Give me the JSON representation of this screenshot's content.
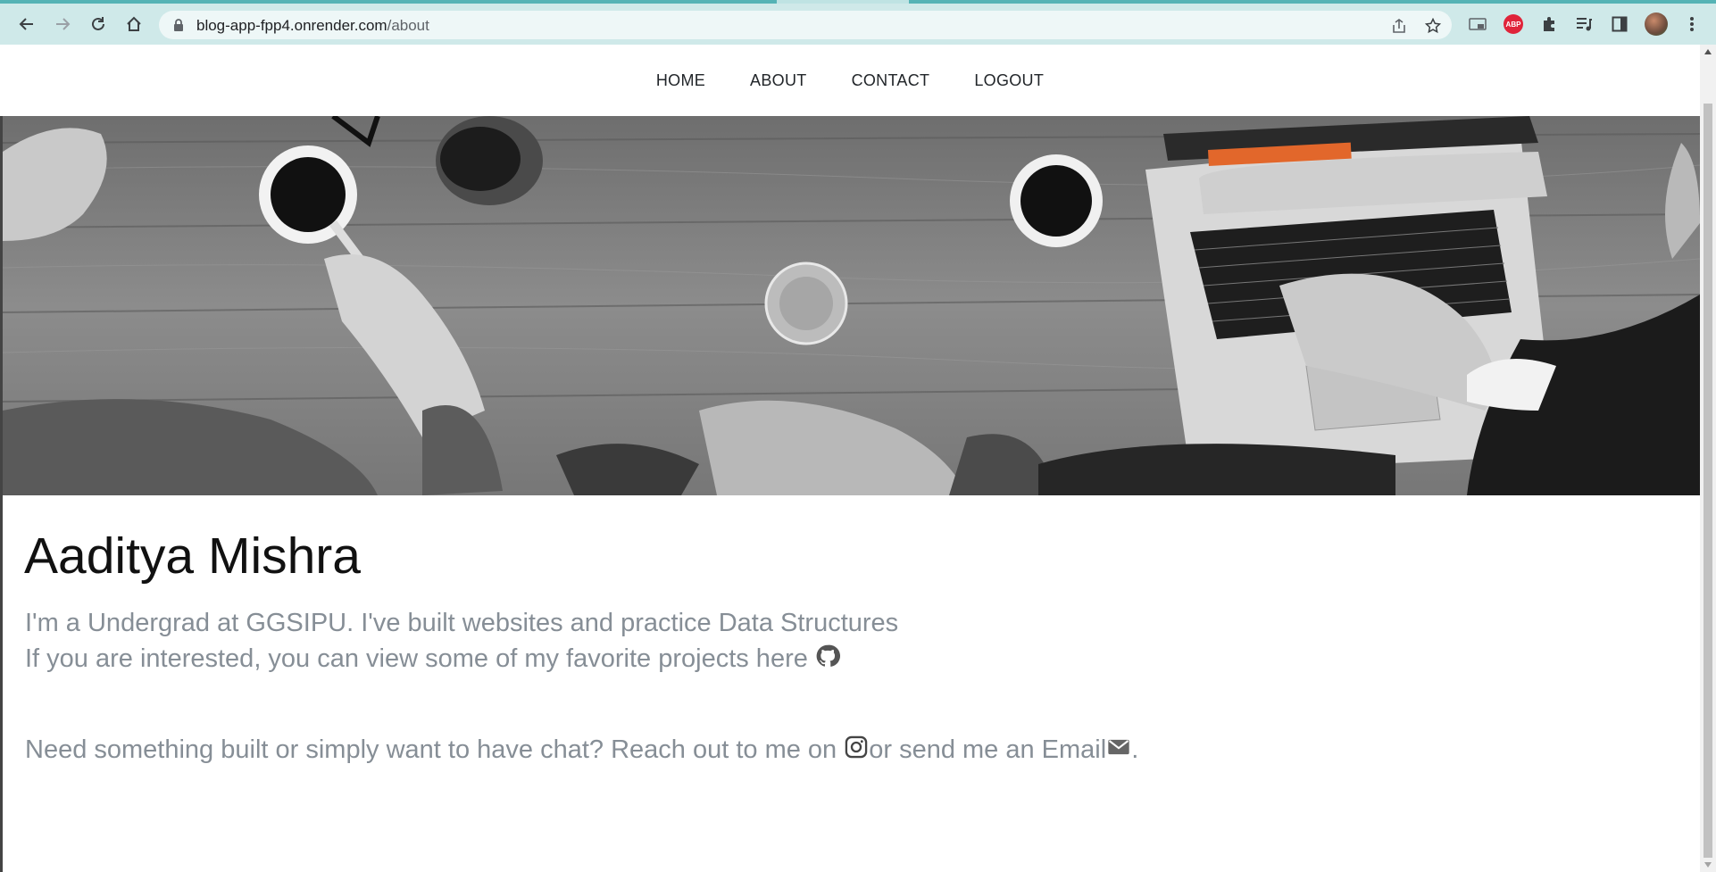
{
  "browser": {
    "url_host": "blog-app-fpp4.onrender.com",
    "url_path": "/about",
    "extension_abp_label": "ABP"
  },
  "nav": {
    "items": [
      {
        "label": "HOME"
      },
      {
        "label": "ABOUT"
      },
      {
        "label": "CONTACT"
      },
      {
        "label": "LOGOUT"
      }
    ]
  },
  "hero": {
    "image_icon": "coffee-meeting-photo"
  },
  "about": {
    "name": "Aaditya Mishra",
    "line1": "I'm a Undergrad at GGSIPU. I've built websites and practice Data Structures",
    "line2": "If you are interested, you can view some of my favorite projects here",
    "line3_start": "Need something built or simply want to have chat? Reach out to me on ",
    "line3_mid": "or send me an Email",
    "line3_end": ".",
    "icons": [
      "github-icon",
      "instagram-icon",
      "email-icon"
    ]
  },
  "colors": {
    "toolbar": "#cfe9e9",
    "text_muted": "#868e96",
    "heading": "#111111"
  }
}
